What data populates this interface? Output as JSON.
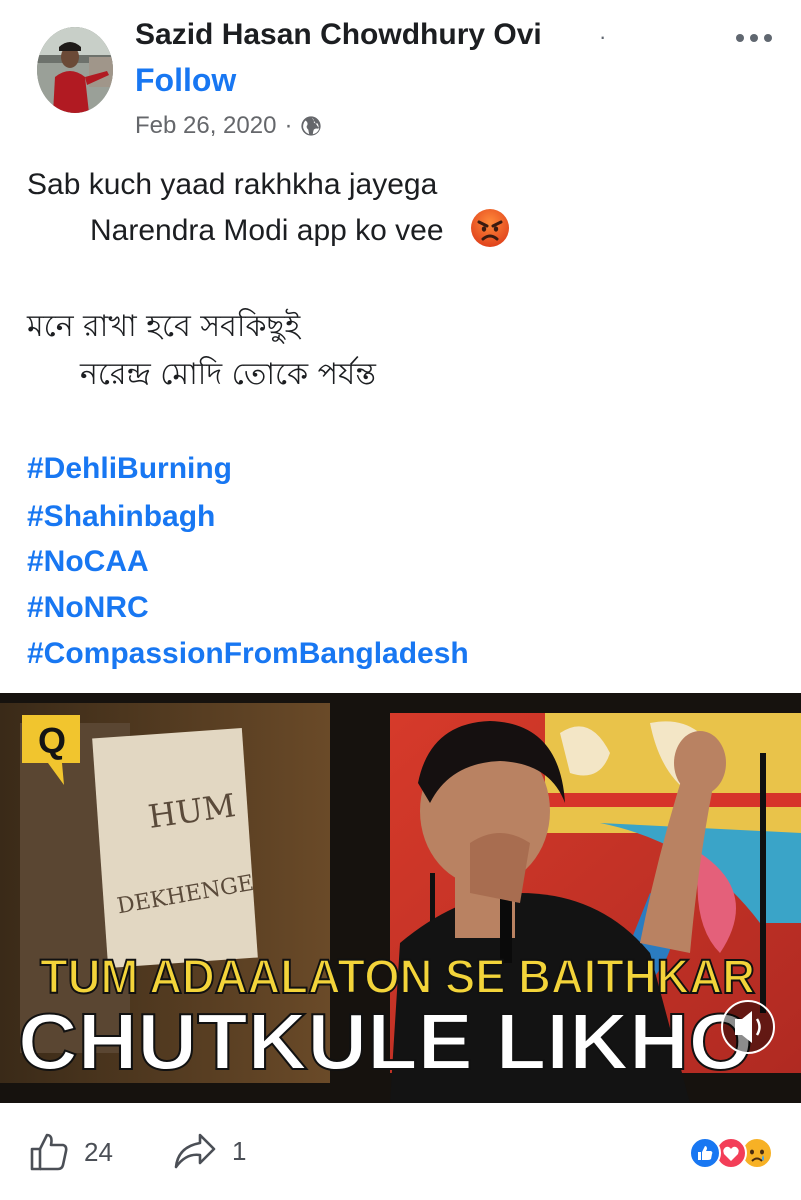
{
  "post": {
    "author": "Sazid Hasan Chowdhury Ovi",
    "separator": "·",
    "follow_label": "Follow",
    "date": "Feb 26, 2020",
    "date_separator": "·",
    "privacy_icon": "globe-icon",
    "lines": [
      "Sab kuch yaad rakhkha jayega",
      "Narendra Modi app ko vee",
      "মনে রাখা হবে সবকিছুই",
      "নরেন্দ্র মোদি তোকে পর্যন্ত"
    ],
    "emoji": "angry-face",
    "hashtags": [
      "#DehliBurning",
      "#Shahinbagh",
      "#NoCAA",
      "#NoNRC",
      "#CompassionFromBangladesh"
    ]
  },
  "video": {
    "logo": "Q",
    "sign_text_1": "HUM",
    "sign_text_2": "DEKHENGE",
    "caption_line1": "TUM ADAALATON SE BAITHKAR",
    "caption_line2": "CHUTKULE LIKHO",
    "mute_icon": "speaker-icon"
  },
  "footer": {
    "likes": "24",
    "shares": "1",
    "like_icon": "thumbs-up-icon",
    "share_icon": "share-arrow-icon",
    "reactions": [
      "like",
      "love",
      "sad"
    ]
  },
  "colors": {
    "link": "#1877f2",
    "text": "#1c1e21",
    "muted": "#65676b",
    "caption_yellow": "#f3d43a",
    "video_bg": "#1a1410"
  }
}
